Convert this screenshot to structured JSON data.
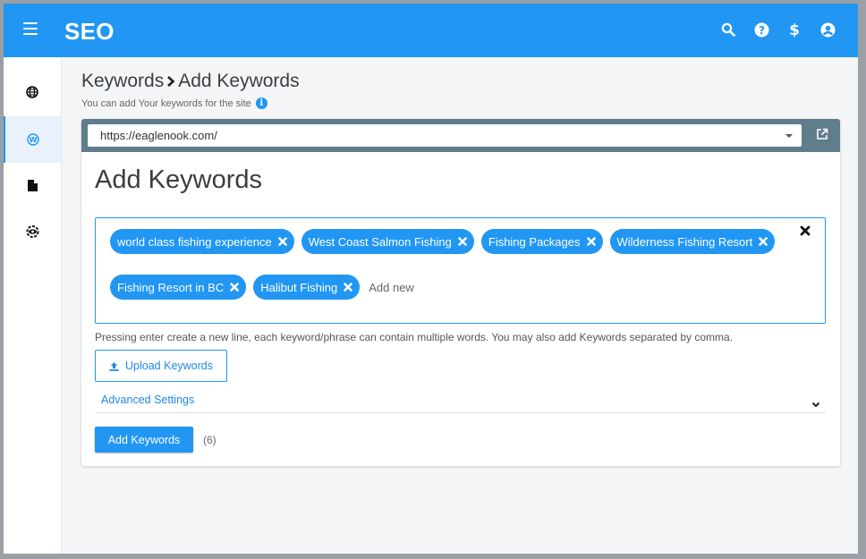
{
  "app": {
    "title": "SEO"
  },
  "header": {
    "icons": [
      "search-icon",
      "help-icon",
      "dollar-icon",
      "account-icon"
    ]
  },
  "sidebar": {
    "items": [
      {
        "icon": "globe-icon",
        "active": false
      },
      {
        "icon": "wordpress-icon",
        "active": true
      },
      {
        "icon": "document-icon",
        "active": false
      },
      {
        "icon": "eye-settings-icon",
        "active": false
      }
    ]
  },
  "breadcrumb": {
    "parent": "Keywords",
    "current": "Add Keywords"
  },
  "subtitle": "You can add Your keywords for the site",
  "site_select": {
    "value": "https://eaglenook.com/"
  },
  "card": {
    "title": "Add Keywords"
  },
  "keywords": {
    "chips": [
      "world class fishing experience",
      "West Coast Salmon Fishing",
      "Fishing Packages",
      "Wilderness Fishing Resort",
      "Fishing Resort in BC",
      "Halibut Fishing"
    ],
    "input_placeholder": "Add new"
  },
  "helper_text": "Pressing enter create a new line, each keyword/phrase can contain multiple words. You may also add Keywords separated by comma.",
  "upload_label": "Upload Keywords",
  "advanced_label": "Advanced Settings",
  "submit_label": "Add Keywords",
  "count_label": "(6)",
  "colors": {
    "accent": "#2196f3",
    "url_bar": "#607d8b"
  }
}
